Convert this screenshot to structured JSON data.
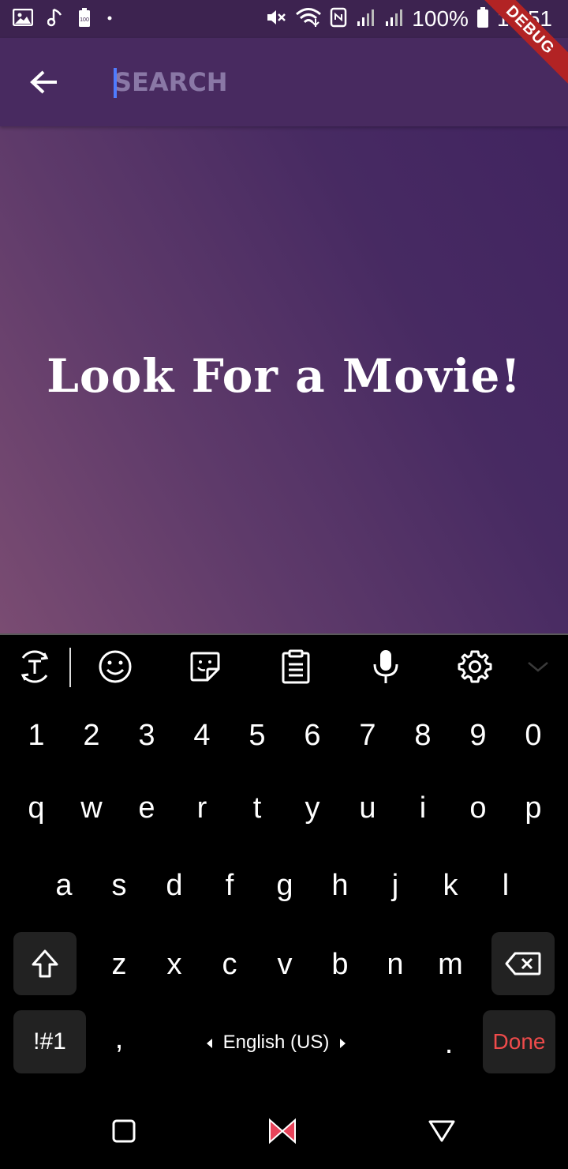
{
  "status_bar": {
    "battery_percent": "100%",
    "time": "14:51",
    "battery_icon_label": "100",
    "icons_left": [
      "gallery-icon",
      "music-note-icon",
      "battery-saver-icon",
      "dot-icon"
    ],
    "icons_right": [
      "mute-icon",
      "wifi-icon",
      "nfc-icon",
      "signal-1-icon",
      "signal-2-icon",
      "battery-icon"
    ]
  },
  "app_bar": {
    "search_placeholder": "SEARCH",
    "search_value": "",
    "debug_label": "DEBUG"
  },
  "main": {
    "title": "Look For a Movie!"
  },
  "keyboard": {
    "toolbar": [
      "text-tools-icon",
      "emoji-icon",
      "sticker-icon",
      "clipboard-icon",
      "microphone-icon",
      "settings-icon",
      "chevron-down-icon"
    ],
    "number_row": [
      "1",
      "2",
      "3",
      "4",
      "5",
      "6",
      "7",
      "8",
      "9",
      "0"
    ],
    "row1": [
      "q",
      "w",
      "e",
      "r",
      "t",
      "y",
      "u",
      "i",
      "o",
      "p"
    ],
    "row2": [
      "a",
      "s",
      "d",
      "f",
      "g",
      "h",
      "j",
      "k",
      "l"
    ],
    "row3": [
      "z",
      "x",
      "c",
      "v",
      "b",
      "n",
      "m"
    ],
    "symbols_label": "!#1",
    "comma": ",",
    "period": ".",
    "language": "English (US)",
    "done_label": "Done"
  },
  "colors": {
    "status_bar": "#3d2350",
    "app_bar": "#482a60",
    "accent_cursor": "#4f7cff",
    "done_text": "#ef4b4b",
    "debug_ribbon": "#b22324"
  }
}
